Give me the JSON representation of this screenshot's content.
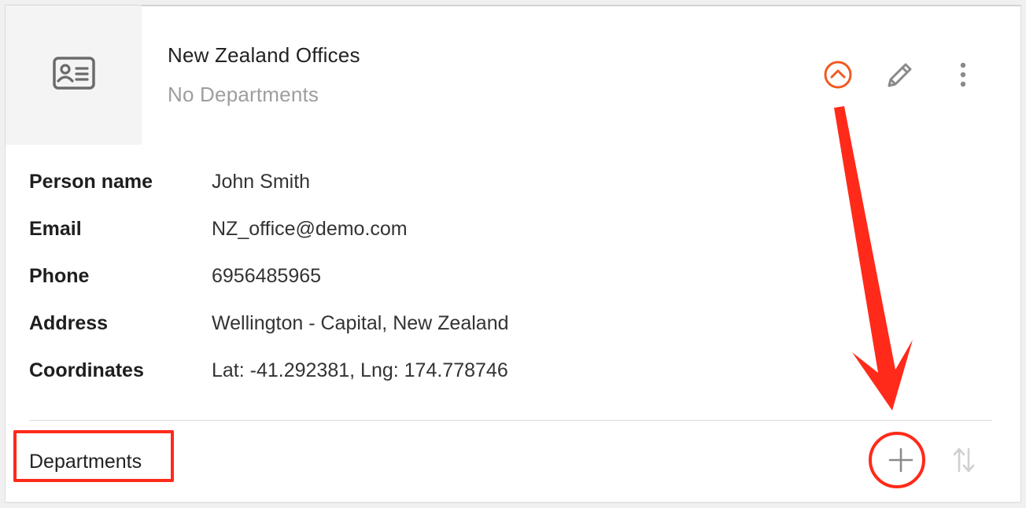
{
  "card": {
    "title": "New Zealand Offices",
    "subtitle": "No Departments",
    "thumbnail_icon": "id-card-icon",
    "actions": {
      "collapse_icon": "chevron-up-circle-icon",
      "edit_icon": "pencil-icon",
      "more_icon": "more-vertical-icon",
      "accent_color": "#f05a22"
    },
    "details": [
      {
        "label": "Person name",
        "value": "John Smith"
      },
      {
        "label": "Email",
        "value": "NZ_office@demo.com"
      },
      {
        "label": "Phone",
        "value": "6956485965"
      },
      {
        "label": "Address",
        "value": "Wellington - Capital, New Zealand"
      },
      {
        "label": "Coordinates",
        "value": "Lat: -41.292381, Lng: 174.778746"
      }
    ],
    "departments": {
      "label": "Departments",
      "add_icon": "plus-icon",
      "sort_icon": "sort-arrows-icon"
    }
  },
  "annotations": {
    "color": "#ff2a1a"
  }
}
